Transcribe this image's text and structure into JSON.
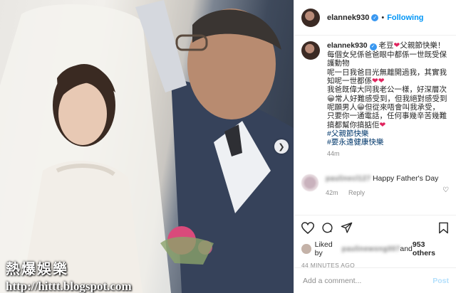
{
  "post": {
    "username": "elannek930",
    "follow_label": "Following",
    "separator": "•",
    "caption": {
      "username": "elannek930",
      "line1": " 老豆",
      "line1b": "父親節快樂！",
      "line2": "每個女兒係爸爸眼中都係一世既受保護動物",
      "line3": "呢一日我爸目光無離開過我，其實我知呢一世都係",
      "line4": "我爸既偉大同我老公一樣，好深層次",
      "line5": "常人好難感受到，但我絕對感受到",
      "line6": "呢願男人",
      "line6b": "但從來唔會叫我承受，",
      "line7": "只要你一通電話，任何事幾辛苦幾難搞都幫你搞掂佢",
      "hashtag1": "#父親節快樂",
      "hashtag2": "#要永遠健康快樂",
      "time": "44m"
    },
    "comment": {
      "user": "paulinecl127",
      "text": " Happy Father's Day",
      "time": "42m",
      "reply_label": "Reply"
    },
    "likes": {
      "prefix": "Liked by ",
      "liker": "paulinewong007",
      "middle": " and ",
      "count": "953 others"
    },
    "timestamp": "44 MINUTES AGO",
    "add_comment_placeholder": "Add a comment...",
    "post_label": "Post"
  },
  "watermark": {
    "brand": "熱爆娛樂",
    "url": "http://hittt.blogspot.com"
  },
  "colors": {
    "link_blue": "#0095f6",
    "heart_red": "#e0245e",
    "hashtag": "#00376b"
  }
}
